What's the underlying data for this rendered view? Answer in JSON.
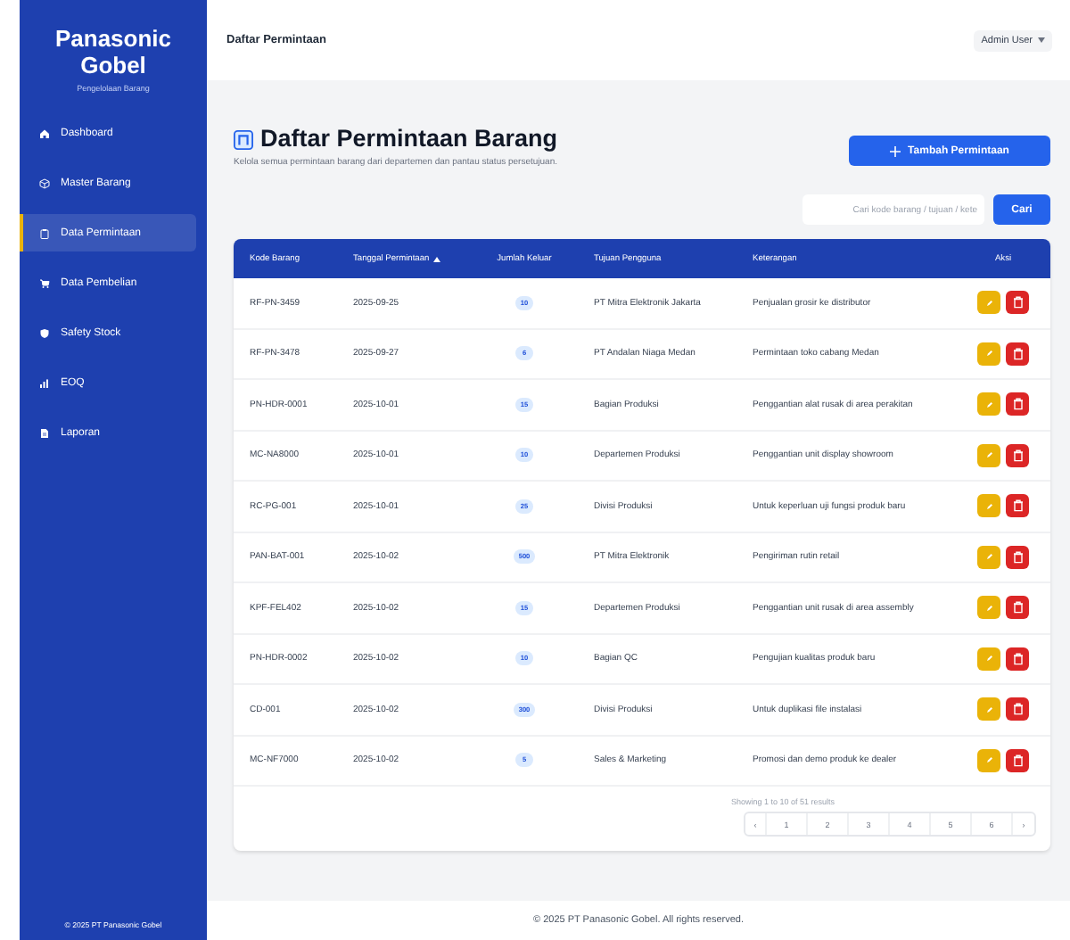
{
  "sidebar": {
    "brand": "Panasonic Gobel",
    "tagline": "Pengelolaan Barang",
    "items": [
      {
        "label": "Dashboard",
        "selected": false
      },
      {
        "label": "Master Barang",
        "selected": false
      },
      {
        "label": "Data Permintaan",
        "selected": true
      },
      {
        "label": "Data Pembelian",
        "selected": false
      },
      {
        "label": "Safety Stock",
        "selected": false
      },
      {
        "label": "EOQ",
        "selected": false
      },
      {
        "label": "Laporan",
        "selected": false
      }
    ],
    "footer": "© 2025 PT Panasonic Gobel"
  },
  "header": {
    "title": "Daftar Permintaan",
    "user": "Admin User"
  },
  "page": {
    "title": "Daftar Permintaan Barang",
    "subtitle": "Kelola semua permintaan barang dari departemen dan pantau status persetujuan.",
    "add_button": "Tambah Permintaan"
  },
  "search": {
    "placeholder": "Cari kode barang / tujuan / kete",
    "button": "Cari"
  },
  "table": {
    "columns": [
      {
        "label": "Kode Barang",
        "sorted": false
      },
      {
        "label": "Tanggal Permintaan",
        "sorted": true
      },
      {
        "label": "Jumlah Keluar",
        "sorted": false
      },
      {
        "label": "Tujuan Pengguna",
        "sorted": false
      },
      {
        "label": "Keterangan",
        "sorted": false
      },
      {
        "label": "Aksi",
        "sorted": false
      }
    ],
    "rows": [
      {
        "code": "RF-PN-3459",
        "date": "2025-09-25",
        "qty": "10",
        "target": "PT Mitra Elektronik Jakarta",
        "note": "Penjualan grosir ke distributor"
      },
      {
        "code": "RF-PN-3478",
        "date": "2025-09-27",
        "qty": "6",
        "target": "PT Andalan Niaga Medan",
        "note": "Permintaan toko cabang Medan"
      },
      {
        "code": "PN-HDR-0001",
        "date": "2025-10-01",
        "qty": "15",
        "target": "Bagian Produksi",
        "note": "Penggantian alat rusak di area perakitan"
      },
      {
        "code": "MC-NA8000",
        "date": "2025-10-01",
        "qty": "10",
        "target": "Departemen Produksi",
        "note": "Penggantian unit display showroom"
      },
      {
        "code": "RC-PG-001",
        "date": "2025-10-01",
        "qty": "25",
        "target": "Divisi Produksi",
        "note": "Untuk keperluan uji fungsi produk baru"
      },
      {
        "code": "PAN-BAT-001",
        "date": "2025-10-02",
        "qty": "500",
        "target": "PT Mitra Elektronik",
        "note": "Pengiriman rutin retail"
      },
      {
        "code": "KPF-FEL402",
        "date": "2025-10-02",
        "qty": "15",
        "target": "Departemen Produksi",
        "note": "Penggantian unit rusak di area assembly"
      },
      {
        "code": "PN-HDR-0002",
        "date": "2025-10-02",
        "qty": "10",
        "target": "Bagian QC",
        "note": "Pengujian kualitas produk baru"
      },
      {
        "code": "CD-001",
        "date": "2025-10-02",
        "qty": "300",
        "target": "Divisi Produksi",
        "note": "Untuk duplikasi file instalasi"
      },
      {
        "code": "MC-NF7000",
        "date": "2025-10-02",
        "qty": "5",
        "target": "Sales & Marketing",
        "note": "Promosi dan demo produk ke dealer"
      }
    ]
  },
  "pagination": {
    "summary": "Showing 1 to 10 of 51 results",
    "prev": "‹",
    "pages": [
      "1",
      "2",
      "3",
      "4",
      "5",
      "6"
    ],
    "next": "›"
  },
  "footer": "© 2025 PT Panasonic Gobel. All rights reserved."
}
